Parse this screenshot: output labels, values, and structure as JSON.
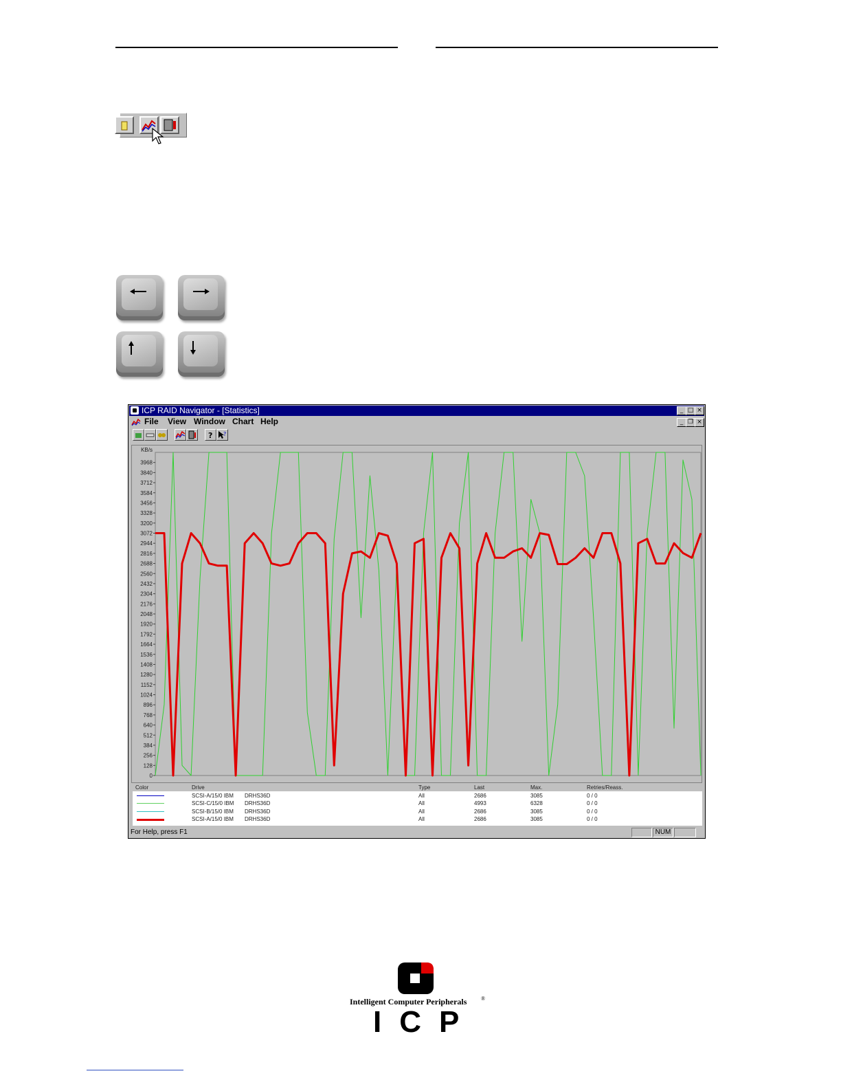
{
  "window": {
    "title": "ICP RAID Navigator - [Statistics]",
    "menu": [
      "File",
      "View",
      "Window",
      "Chart",
      "Help"
    ],
    "status_text": "For Help, press F1",
    "status_num": "NUM"
  },
  "legend": {
    "headers": [
      "Color",
      "Drive",
      "Type",
      "Last",
      "Max.",
      "Retries/Reass."
    ],
    "rows": [
      {
        "drive": "SCSI-A/15/0 IBM",
        "model": "DRHS36D",
        "type": "All",
        "last": "2686",
        "max": "3085",
        "retries": "0 / 0",
        "color": "#0000c0",
        "weight": 1
      },
      {
        "drive": "SCSI-C/15/0 IBM",
        "model": "DRHS36D",
        "type": "All",
        "last": "4993",
        "max": "6328",
        "retries": "0 / 0",
        "color": "#60d060",
        "weight": 1
      },
      {
        "drive": "SCSI-B/15/0 IBM",
        "model": "DRHS36D",
        "type": "All",
        "last": "2686",
        "max": "3085",
        "retries": "0 / 0",
        "color": "#30c0c0",
        "weight": 1
      },
      {
        "drive": "SCSI-A/15/0 IBM",
        "model": "DRHS36D",
        "type": "All",
        "last": "2686",
        "max": "3085",
        "retries": "0 / 0",
        "color": "#e00000",
        "weight": 3
      }
    ]
  },
  "logo": {
    "tagline": "Intelligent Computer Peripherals",
    "reg": "®",
    "wordmark": "ICP"
  },
  "chart_data": {
    "type": "line",
    "ylabel": "KB/s",
    "yticks": [
      "0",
      "128",
      "256",
      "384",
      "512",
      "640",
      "768",
      "896",
      "1024",
      "1152",
      "1280",
      "1408",
      "1536",
      "1664",
      "1792",
      "1920",
      "2048",
      "2176",
      "2304",
      "2432",
      "2560",
      "2688",
      "2816",
      "2944",
      "3072",
      "3200",
      "3328",
      "3456",
      "3584",
      "3712",
      "3840",
      "3968"
    ],
    "ylim": [
      0,
      4096
    ],
    "grid": false,
    "xlim": [
      0,
      70
    ],
    "series": [
      {
        "color": "#e00000",
        "width": 3,
        "values": [
          3072,
          3072,
          0,
          2688,
          3072,
          2944,
          2688,
          2660,
          2660,
          0,
          2944,
          3072,
          2944,
          2688,
          2660,
          2688,
          2944,
          3072,
          3072,
          2944,
          128,
          2304,
          2816,
          2840,
          2760,
          3072,
          3040,
          2688,
          0,
          2944,
          3000,
          0,
          2760,
          3072,
          2880,
          128,
          2688,
          3072,
          2760,
          2760,
          2840,
          2880,
          2760,
          3072,
          3050,
          2680,
          2680,
          2760,
          2880,
          2760,
          3072,
          3072,
          2688,
          0,
          2944,
          3000,
          2688,
          2688,
          2944,
          2820,
          2760,
          3072
        ]
      },
      {
        "color": "#30d030",
        "width": 1,
        "values": [
          0,
          900,
          4096,
          128,
          0,
          2500,
          4096,
          4096,
          4096,
          0,
          0,
          0,
          0,
          3072,
          4096,
          4096,
          4096,
          800,
          0,
          0,
          3000,
          4096,
          4096,
          2000,
          3800,
          2600,
          0,
          2688,
          0,
          0,
          3072,
          4096,
          0,
          0,
          3200,
          4096,
          0,
          0,
          3072,
          4096,
          4096,
          1700,
          3500,
          3072,
          0,
          900,
          4096,
          4096,
          3800,
          2000,
          0,
          0,
          4096,
          4096,
          0,
          3072,
          4096,
          4096,
          600,
          4000,
          3500,
          0
        ]
      }
    ]
  }
}
